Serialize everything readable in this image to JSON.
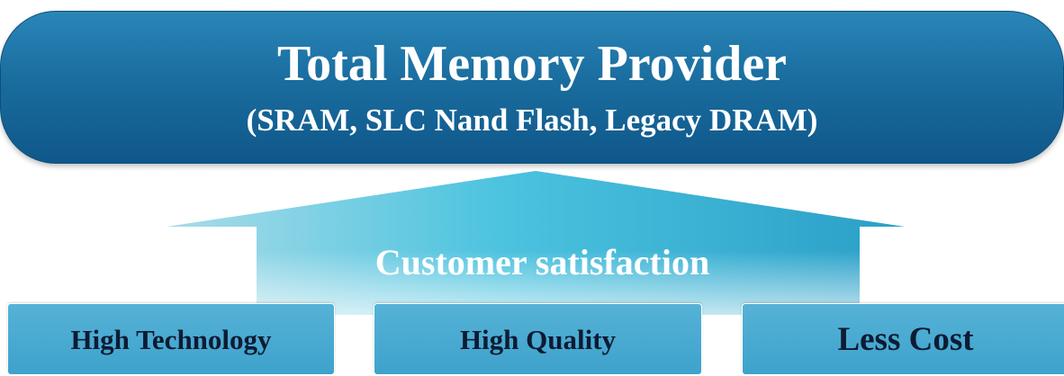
{
  "banner": {
    "title": "Total Memory Provider",
    "subtitle": "(SRAM, SLC Nand Flash, Legacy DRAM)"
  },
  "foundation": {
    "label": "Customer satisfaction"
  },
  "pillars": [
    {
      "label": "High Technology"
    },
    {
      "label": "High Quality"
    },
    {
      "label": "Less Cost"
    }
  ],
  "colors": {
    "banner": "#1a6d9f",
    "roof": "#4cc0dc",
    "pillar": "#4aa9d1",
    "pillar_text": "#0d1b33"
  }
}
